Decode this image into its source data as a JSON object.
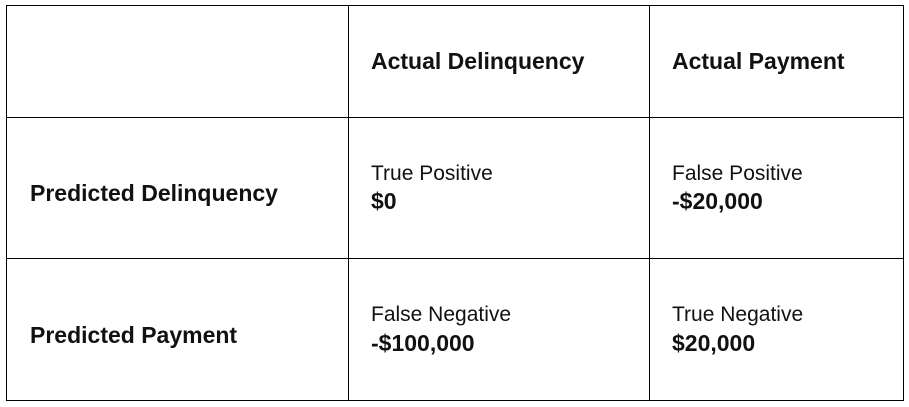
{
  "matrix": {
    "corner": "",
    "columns": [
      "Actual Delinquency",
      "Actual Payment"
    ],
    "rows": [
      {
        "label": "Predicted Delinquency",
        "cells": [
          {
            "outcome": "True Positive",
            "value": "$0"
          },
          {
            "outcome": "False Positive",
            "value": "-$20,000"
          }
        ]
      },
      {
        "label": "Predicted Payment",
        "cells": [
          {
            "outcome": "False Negative",
            "value": "-$100,000"
          },
          {
            "outcome": "True Negative",
            "value": "$20,000"
          }
        ]
      }
    ]
  }
}
